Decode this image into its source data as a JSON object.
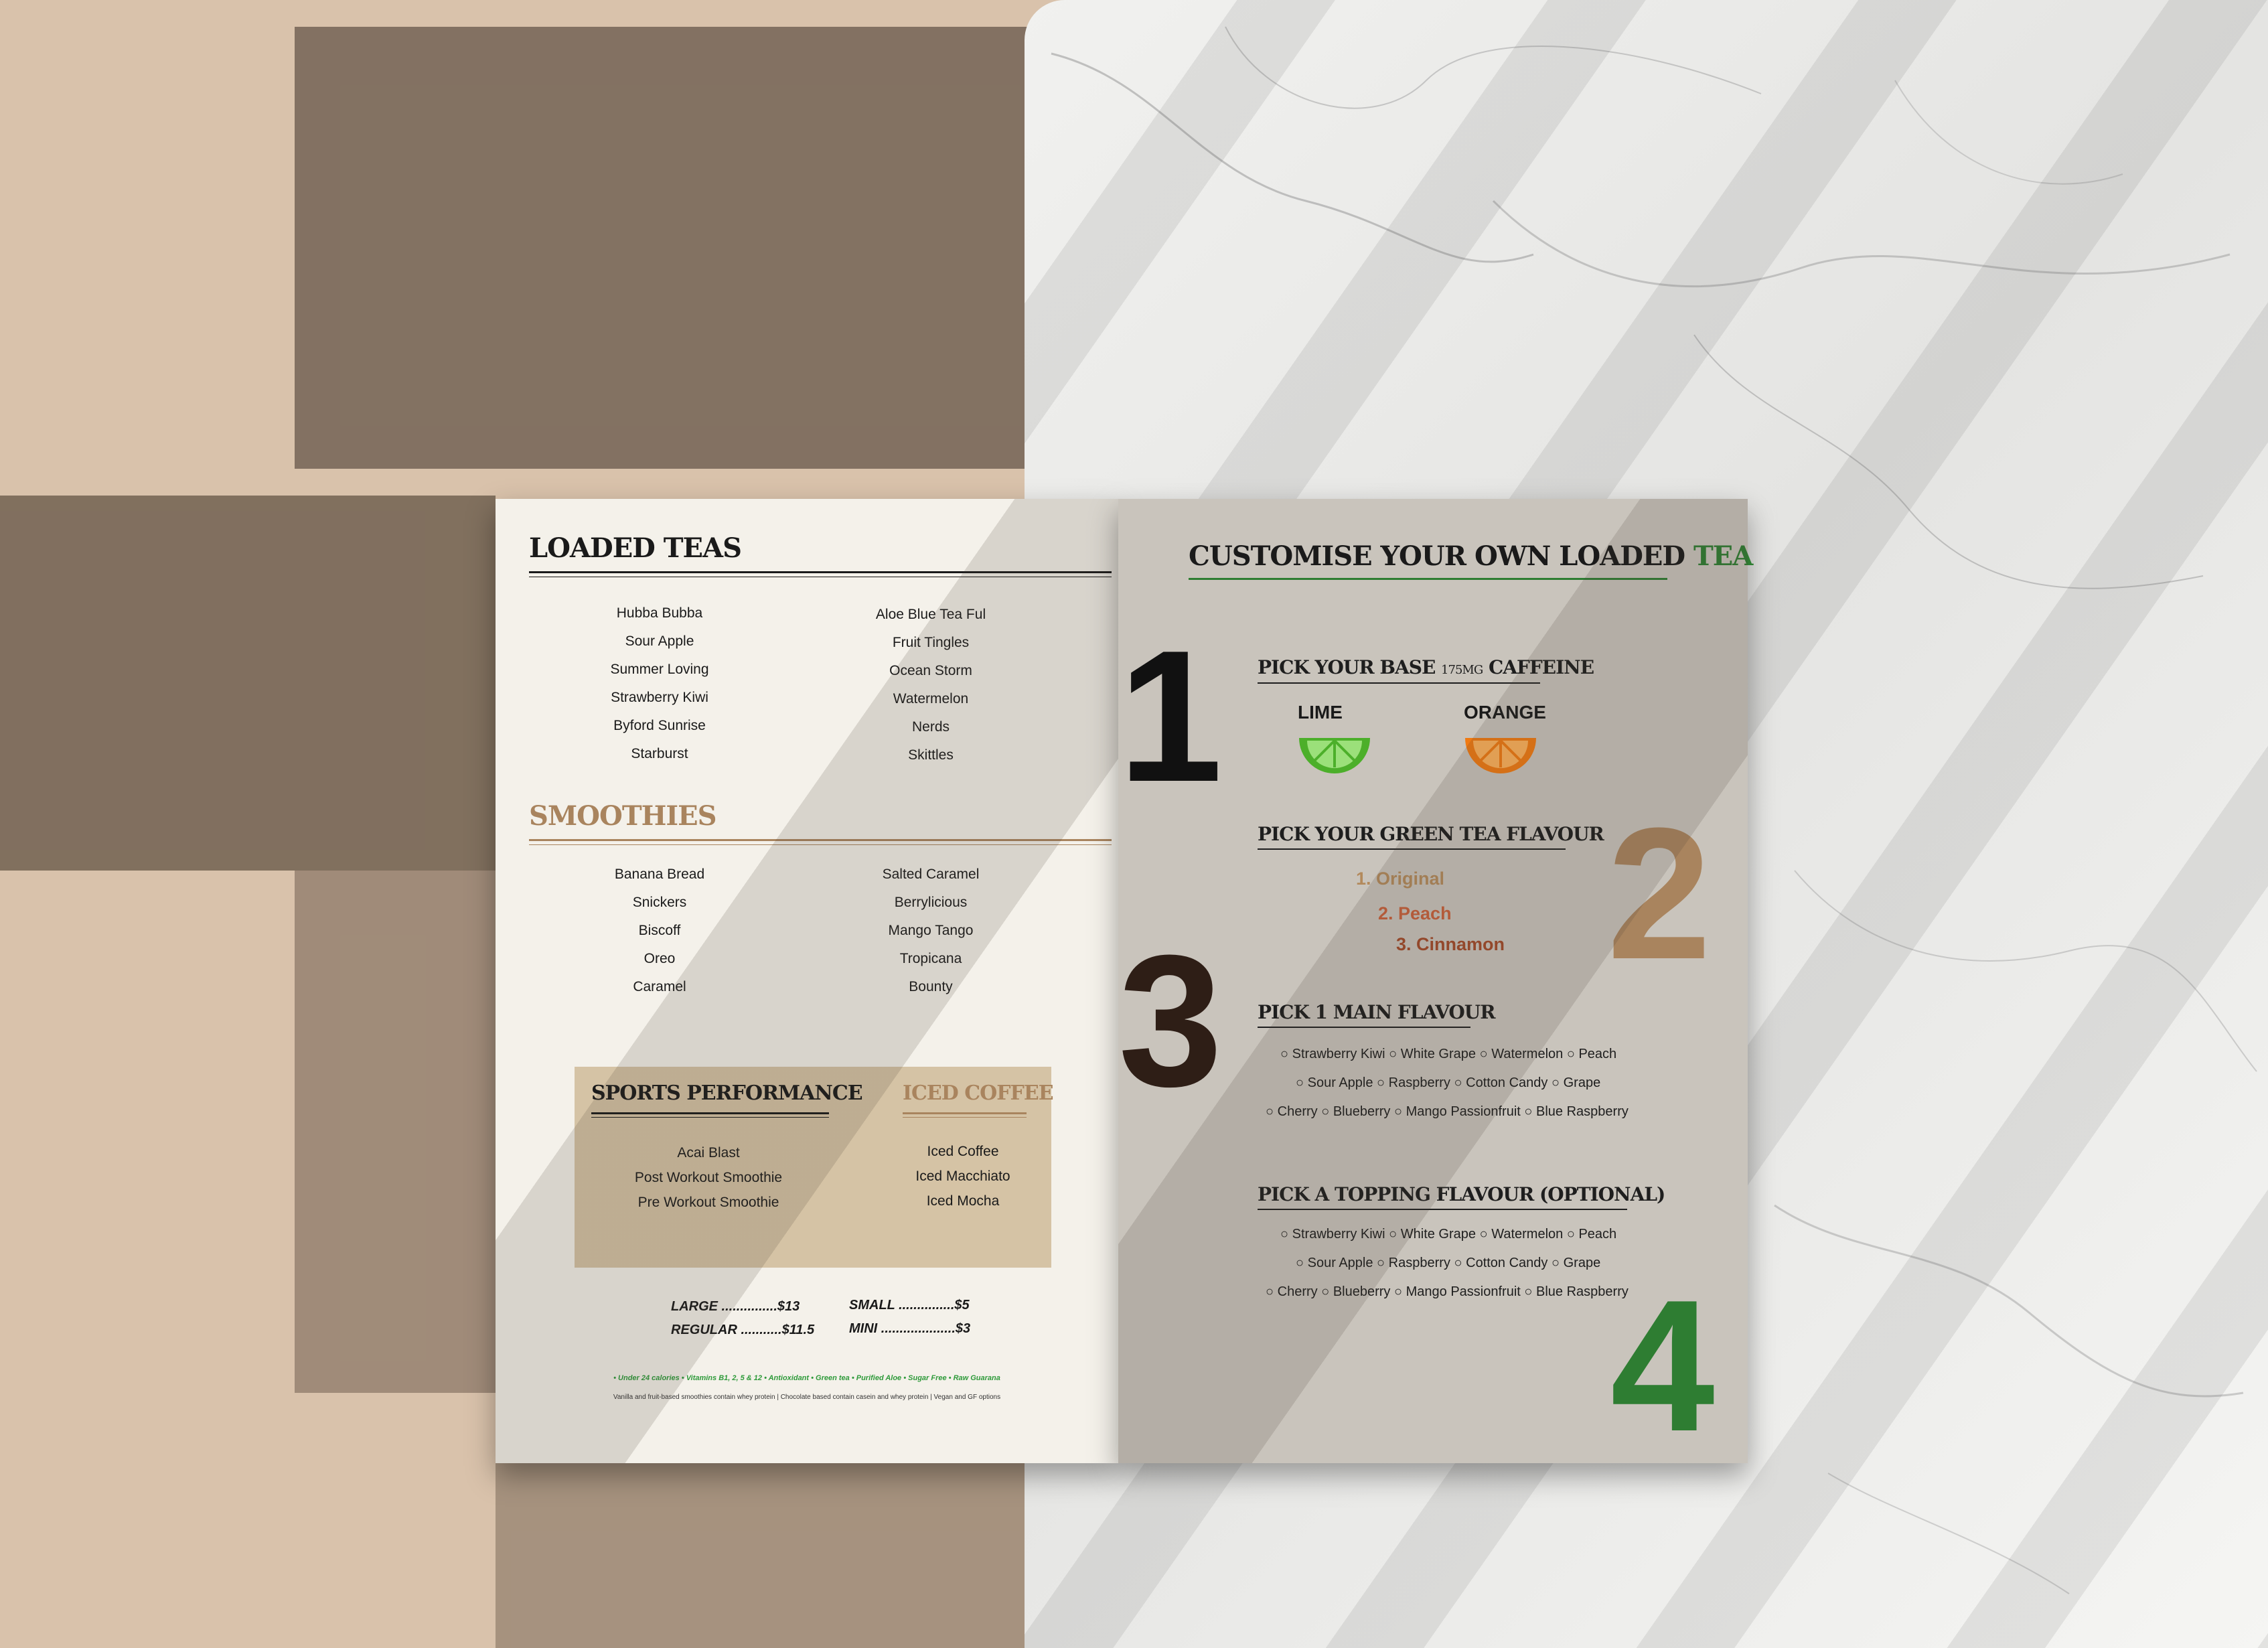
{
  "colors": {
    "brown": "#a9845e",
    "green": "#2e7d32",
    "dark": "#1a1a1a",
    "rust": "#b5502e",
    "peach": "#c8613c",
    "lime": "#4caf2a",
    "orange": "#f07a12"
  },
  "left": {
    "loaded_teas": {
      "title": "LOADED TEAS",
      "col1": [
        "Hubba Bubba",
        "Sour Apple",
        "Summer Loving",
        "Strawberry Kiwi",
        "Byford Sunrise",
        "Starburst"
      ],
      "col2": [
        "Aloe Blue Tea Ful",
        "Fruit Tingles",
        "Ocean Storm",
        "Watermelon",
        "Nerds",
        "Skittles"
      ]
    },
    "smoothies": {
      "title": "SMOOTHIES",
      "col1": [
        "Banana Bread",
        "Snickers",
        "Biscoff",
        "Oreo",
        "Caramel"
      ],
      "col2": [
        "Salted Caramel",
        "Berrylicious",
        "Mango Tango",
        "Tropicana",
        "Bounty"
      ]
    },
    "sports": {
      "title": "SPORTS PERFORMANCE",
      "items": [
        "Acai Blast",
        "Post Workout Smoothie",
        "Pre Workout Smoothie"
      ]
    },
    "iced_coffee": {
      "title": "ICED COFFEE",
      "items": [
        "Iced Coffee",
        "Iced Macchiato",
        "Iced Mocha"
      ]
    },
    "prices": {
      "large": "LARGE ...............$13",
      "regular": "REGULAR ...........$11.5",
      "small": "SMALL ...............$5",
      "mini": "MINI ....................$3"
    },
    "footer_green": "• Under 24 calories • Vitamins B1, 2, 5 & 12 • Antioxidant • Green tea • Purified Aloe • Sugar Free • Raw Guarana",
    "footer_note": "Vanilla and fruit-based smoothies contain whey protein | Chocolate based contain casein and whey protein | Vegan and GF options"
  },
  "right": {
    "title_main": "CUSTOMISE YOUR OWN LOADED",
    "title_accent": "TEA",
    "step1": {
      "number": "1",
      "title": "PICK YOUR BASE",
      "caffeine": "175MG",
      "title_end": "CAFFEINE",
      "option1": "LIME",
      "option2": "ORANGE"
    },
    "step2": {
      "number": "2",
      "title": "PICK YOUR GREEN TEA FLAVOUR",
      "options": [
        "1. Original",
        "2. Peach",
        "3. Cinnamon"
      ]
    },
    "step3": {
      "number": "3",
      "title": "PICK 1 MAIN FLAVOUR",
      "lines": [
        "○ Strawberry Kiwi ○ White Grape ○ Watermelon ○ Peach",
        "○ Sour Apple ○ Raspberry ○ Cotton Candy ○ Grape",
        "○ Cherry ○ Blueberry ○ Mango Passionfruit ○ Blue Raspberry"
      ]
    },
    "step4": {
      "number": "4",
      "title": "PICK A TOPPING FLAVOUR (OPTIONAL)",
      "lines": [
        "○ Strawberry Kiwi ○ White Grape ○ Watermelon ○ Peach",
        "○ Sour Apple ○ Raspberry ○ Cotton Candy ○ Grape",
        "○ Cherry ○ Blueberry ○ Mango Passionfruit ○ Blue Raspberry"
      ]
    }
  }
}
